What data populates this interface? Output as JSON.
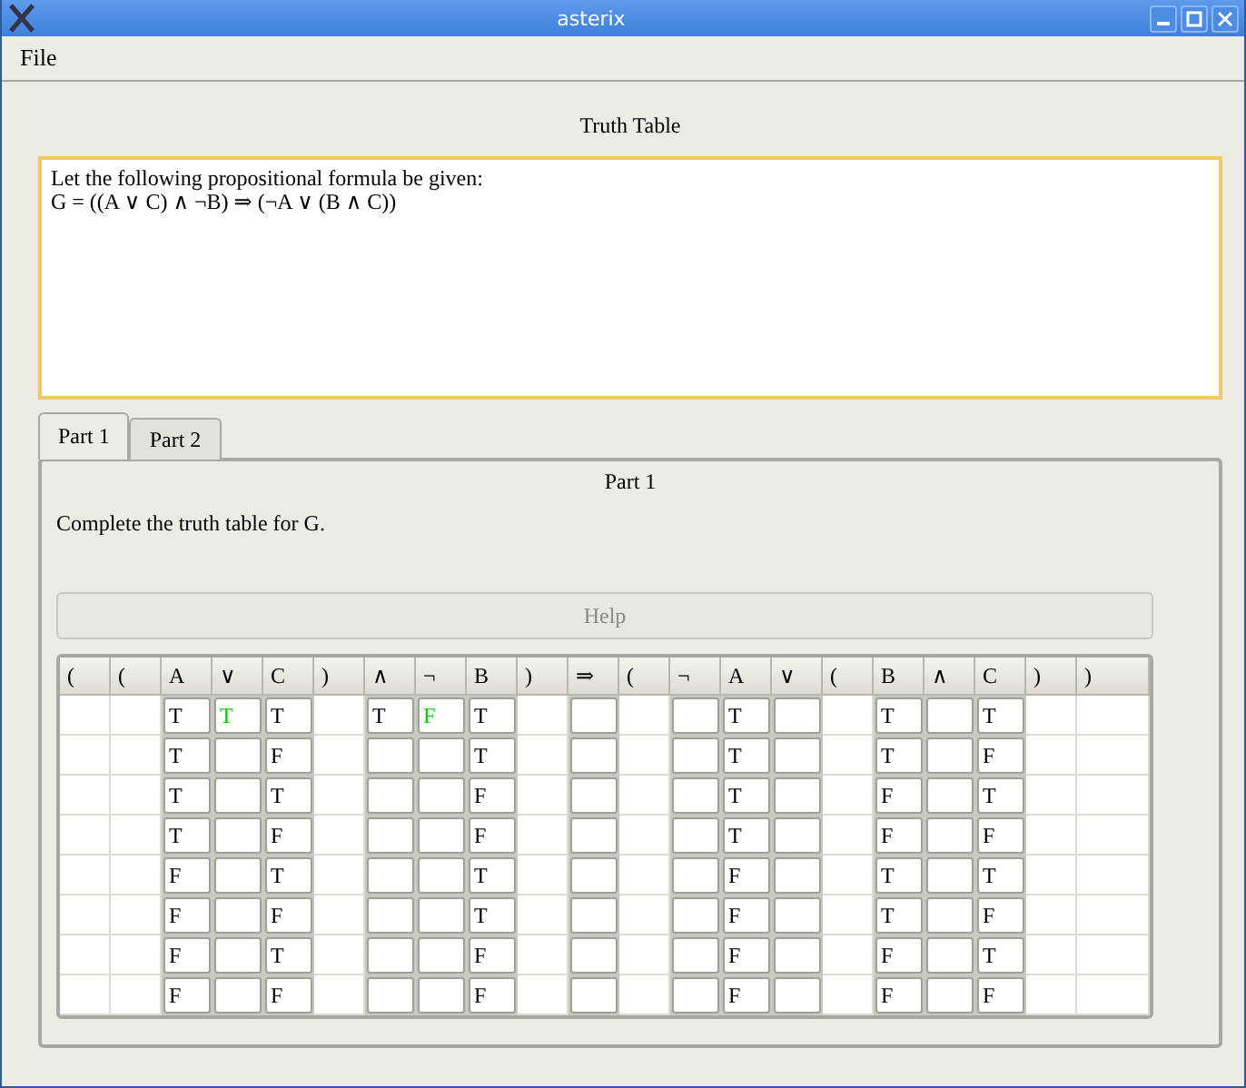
{
  "window": {
    "title": "asterix"
  },
  "menu": [
    "File"
  ],
  "heading": "Truth Table",
  "problem": [
    "Let the following propositional formula be given:",
    "G = ((A ∨ C) ∧ ¬B) ⇒ (¬A ∨ (B ∧ C))"
  ],
  "tabs": [
    {
      "label": "Part 1",
      "selected": true
    },
    {
      "label": "Part 2",
      "selected": false
    }
  ],
  "part": {
    "title": "Part 1",
    "instruction": "Complete the truth table for G.",
    "help_button": {
      "label": "Help",
      "disabled": true
    }
  },
  "table": {
    "columns": [
      {
        "label": "(",
        "kind": "plain"
      },
      {
        "label": "(",
        "kind": "plain"
      },
      {
        "label": "A",
        "kind": "input"
      },
      {
        "label": "∨",
        "kind": "input"
      },
      {
        "label": "C",
        "kind": "input"
      },
      {
        "label": ")",
        "kind": "plain"
      },
      {
        "label": "∧",
        "kind": "input"
      },
      {
        "label": "¬",
        "kind": "input"
      },
      {
        "label": "B",
        "kind": "input"
      },
      {
        "label": ")",
        "kind": "plain"
      },
      {
        "label": "⇒",
        "kind": "input"
      },
      {
        "label": "(",
        "kind": "plain"
      },
      {
        "label": "¬",
        "kind": "input"
      },
      {
        "label": "A",
        "kind": "input"
      },
      {
        "label": "∨",
        "kind": "input"
      },
      {
        "label": "(",
        "kind": "plain"
      },
      {
        "label": "B",
        "kind": "input"
      },
      {
        "label": "∧",
        "kind": "input"
      },
      {
        "label": "C",
        "kind": "input"
      },
      {
        "label": ")",
        "kind": "plain"
      },
      {
        "label": ")",
        "kind": "plain"
      }
    ],
    "rows": [
      [
        {},
        {},
        {
          "value": "T",
          "color": "#000000"
        },
        {
          "value": "T",
          "color": "#00cc00"
        },
        {
          "value": "T",
          "color": "#000000"
        },
        {},
        {
          "value": "T",
          "color": "#000000"
        },
        {
          "value": "F",
          "color": "#00cc00"
        },
        {
          "value": "T",
          "color": "#000000"
        },
        {},
        {},
        {},
        {},
        {
          "value": "T",
          "color": "#000000"
        },
        {},
        {},
        {
          "value": "T",
          "color": "#000000"
        },
        {},
        {
          "value": "T",
          "color": "#000000"
        },
        {},
        {}
      ],
      [
        {},
        {},
        {
          "value": "T",
          "color": "#000000"
        },
        {},
        {
          "value": "F",
          "color": "#000000"
        },
        {},
        {},
        {},
        {
          "value": "T",
          "color": "#000000"
        },
        {},
        {},
        {},
        {},
        {
          "value": "T",
          "color": "#000000"
        },
        {},
        {},
        {
          "value": "T",
          "color": "#000000"
        },
        {},
        {
          "value": "F",
          "color": "#000000"
        },
        {},
        {}
      ],
      [
        {},
        {},
        {
          "value": "T",
          "color": "#000000"
        },
        {},
        {
          "value": "T",
          "color": "#000000"
        },
        {},
        {},
        {},
        {
          "value": "F",
          "color": "#000000"
        },
        {},
        {},
        {},
        {},
        {
          "value": "T",
          "color": "#000000"
        },
        {},
        {},
        {
          "value": "F",
          "color": "#000000"
        },
        {},
        {
          "value": "T",
          "color": "#000000"
        },
        {},
        {}
      ],
      [
        {},
        {},
        {
          "value": "T",
          "color": "#000000"
        },
        {},
        {
          "value": "F",
          "color": "#000000"
        },
        {},
        {},
        {},
        {
          "value": "F",
          "color": "#000000"
        },
        {},
        {},
        {},
        {},
        {
          "value": "T",
          "color": "#000000"
        },
        {},
        {},
        {
          "value": "F",
          "color": "#000000"
        },
        {},
        {
          "value": "F",
          "color": "#000000"
        },
        {},
        {}
      ],
      [
        {},
        {},
        {
          "value": "F",
          "color": "#000000"
        },
        {},
        {
          "value": "T",
          "color": "#000000"
        },
        {},
        {},
        {},
        {
          "value": "T",
          "color": "#000000"
        },
        {},
        {},
        {},
        {},
        {
          "value": "F",
          "color": "#000000"
        },
        {},
        {},
        {
          "value": "T",
          "color": "#000000"
        },
        {},
        {
          "value": "T",
          "color": "#000000"
        },
        {},
        {}
      ],
      [
        {},
        {},
        {
          "value": "F",
          "color": "#000000"
        },
        {},
        {
          "value": "F",
          "color": "#000000"
        },
        {},
        {},
        {},
        {
          "value": "T",
          "color": "#000000"
        },
        {},
        {},
        {},
        {},
        {
          "value": "F",
          "color": "#000000"
        },
        {},
        {},
        {
          "value": "T",
          "color": "#000000"
        },
        {},
        {
          "value": "F",
          "color": "#000000"
        },
        {},
        {}
      ],
      [
        {},
        {},
        {
          "value": "F",
          "color": "#000000"
        },
        {},
        {
          "value": "T",
          "color": "#000000"
        },
        {},
        {},
        {},
        {
          "value": "F",
          "color": "#000000"
        },
        {},
        {},
        {},
        {},
        {
          "value": "F",
          "color": "#000000"
        },
        {},
        {},
        {
          "value": "F",
          "color": "#000000"
        },
        {},
        {
          "value": "T",
          "color": "#000000"
        },
        {},
        {}
      ],
      [
        {},
        {},
        {
          "value": "F",
          "color": "#000000"
        },
        {},
        {
          "value": "F",
          "color": "#000000"
        },
        {},
        {},
        {},
        {
          "value": "F",
          "color": "#000000"
        },
        {},
        {},
        {},
        {},
        {
          "value": "F",
          "color": "#000000"
        },
        {},
        {},
        {
          "value": "F",
          "color": "#000000"
        },
        {},
        {
          "value": "F",
          "color": "#000000"
        },
        {},
        {}
      ]
    ]
  }
}
